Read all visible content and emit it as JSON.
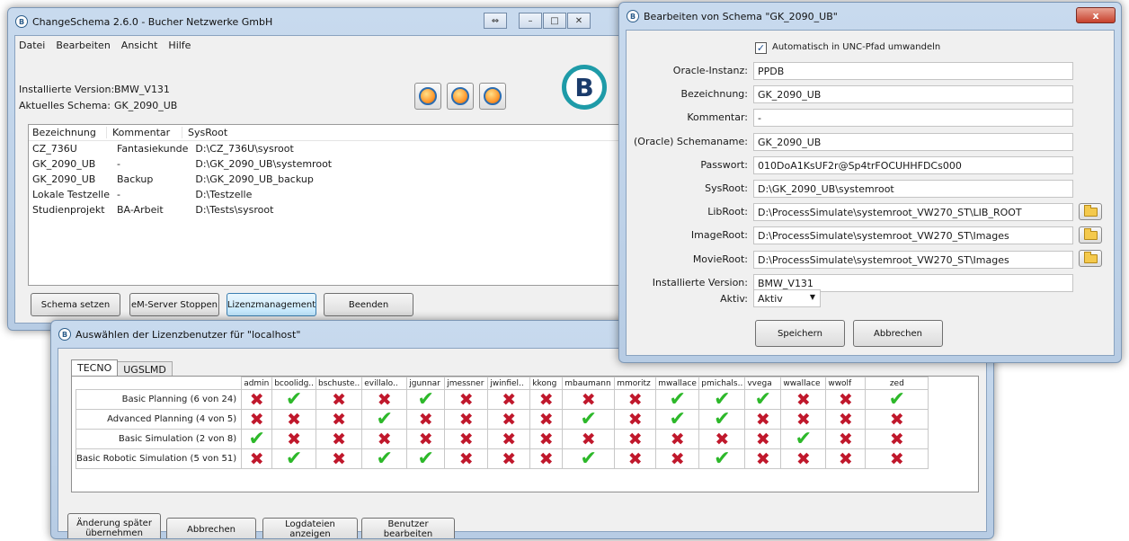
{
  "main_window": {
    "title": "ChangeSchema 2.6.0 - Bucher Netzwerke GmbH",
    "menu": [
      "Datei",
      "Bearbeiten",
      "Ansicht",
      "Hilfe"
    ],
    "installed_version_label": "Installierte Version:",
    "installed_version_value": "BMW_V131",
    "current_schema_label": "Aktuelles Schema:",
    "current_schema_value": "GK_2090_UB",
    "logo_letter": "B",
    "columns": [
      "Bezeichnung",
      "Kommentar",
      "SysRoot"
    ],
    "rows": [
      [
        "CZ_736U",
        "Fantasiekunde",
        "D:\\CZ_736U\\sysroot"
      ],
      [
        "GK_2090_UB",
        "-",
        "D:\\GK_2090_UB\\systemroot"
      ],
      [
        "GK_2090_UB",
        "Backup",
        "D:\\GK_2090_UB_backup"
      ],
      [
        "Lokale Testzelle",
        "-",
        "D:\\Testzelle"
      ],
      [
        "Studienprojekt",
        "BA-Arbeit",
        "D:\\Tests\\sysroot"
      ]
    ],
    "buttons": {
      "set_schema": "Schema setzen",
      "stop_server": "eM-Server Stoppen",
      "license": "Lizenzmanagement",
      "quit": "Beenden"
    },
    "caption": {
      "restore": "⇔",
      "minimize": "–",
      "maximize": "□",
      "close": "✕"
    }
  },
  "edit_dialog": {
    "title": "Bearbeiten von Schema \"GK_2090_UB\"",
    "close": "x",
    "unc_checkbox_label": "Automatisch in UNC-Pfad umwandeln",
    "fields": [
      {
        "label": "Oracle-Instanz:",
        "value": "PPDB"
      },
      {
        "label": "Bezeichnung:",
        "value": "GK_2090_UB"
      },
      {
        "label": "Kommentar:",
        "value": "-"
      },
      {
        "label": "(Oracle) Schemaname:",
        "value": "GK_2090_UB"
      },
      {
        "label": "Passwort:",
        "value": "010DoA1KsUF2r@Sp4trFOCUHHFDCs000"
      },
      {
        "label": "SysRoot:",
        "value": "D:\\GK_2090_UB\\systemroot"
      },
      {
        "label": "LibRoot:",
        "value": "D:\\ProcessSimulate\\systemroot_VW270_ST\\LIB_ROOT"
      },
      {
        "label": "ImageRoot:",
        "value": "D:\\ProcessSimulate\\systemroot_VW270_ST\\Images"
      },
      {
        "label": "MovieRoot:",
        "value": "D:\\ProcessSimulate\\systemroot_VW270_ST\\Images"
      },
      {
        "label": "Installierte Version:",
        "value": "BMW_V131"
      }
    ],
    "active_label": "Aktiv:",
    "active_value": "Aktiv",
    "save": "Speichern",
    "cancel": "Abbrechen"
  },
  "license_dialog": {
    "title": "Auswählen der Lizenzbenutzer für \"localhost\"",
    "tabs": [
      "TECNO",
      "UGSLMD"
    ],
    "users": [
      "admin",
      "bcoolidg..",
      "bschuste..",
      "evillalo..",
      "jgunnar",
      "jmessner",
      "jwinfiel..",
      "kkong",
      "mbaumann",
      "mmoritz",
      "mwallace",
      "pmichals..",
      "vvega",
      "wwallace",
      "wwolf",
      "zed"
    ],
    "licenses": [
      {
        "name": "Basic Planning (6 von 24)",
        "marks": [
          0,
          1,
          0,
          0,
          1,
          0,
          0,
          0,
          0,
          0,
          1,
          1,
          1,
          0,
          0,
          1
        ]
      },
      {
        "name": "Advanced Planning (4 von 5)",
        "marks": [
          0,
          0,
          0,
          1,
          0,
          0,
          0,
          0,
          1,
          0,
          1,
          1,
          0,
          0,
          0,
          0
        ]
      },
      {
        "name": "Basic Simulation (2 von 8)",
        "marks": [
          1,
          0,
          0,
          0,
          0,
          0,
          0,
          0,
          0,
          0,
          0,
          0,
          0,
          1,
          0,
          0
        ]
      },
      {
        "name": "Basic Robotic Simulation (5 von 51)",
        "marks": [
          0,
          1,
          0,
          1,
          1,
          0,
          0,
          0,
          1,
          0,
          0,
          1,
          0,
          0,
          0,
          0
        ]
      }
    ],
    "buttons": {
      "apply_later": "Änderung später übernehmen",
      "cancel": "Abbrechen",
      "logs": "Logdateien anzeigen",
      "edit_users": "Benutzer bearbeiten"
    }
  }
}
